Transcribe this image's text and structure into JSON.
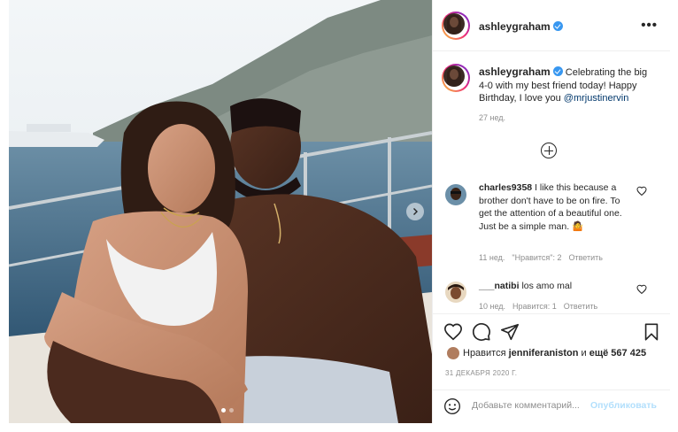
{
  "header": {
    "username": "ashleygraham",
    "more_icon": "more-horizontal-icon"
  },
  "caption": {
    "username": "ashleygraham",
    "text": "Celebrating the big 4-0 with my best friend today! Happy Birthday, I love you",
    "mention": "@mrjustinervin",
    "time": "27 нед."
  },
  "comments": [
    {
      "username": "charles9358",
      "text": "I like this because a brother don't have to be on fire. To get the attention of a beautiful one. Just be a simple man.",
      "emoji": "🤷",
      "time": "11 нед.",
      "likes": "\"Нравится\": 2",
      "reply": "Ответить"
    },
    {
      "username": "___natibi",
      "text": "los amo mal",
      "time": "10 нед.",
      "likes": "Нравится: 1",
      "reply": "Ответить"
    }
  ],
  "likes": {
    "prefix": "Нравится",
    "user": "jenniferaniston",
    "middle": "и",
    "others": "ещё 567 425"
  },
  "date": "31 ДЕКАБРЯ 2020 Г.",
  "add_comment": {
    "placeholder": "Добавьте комментарий...",
    "post_label": "Опубликовать"
  },
  "carousel": {
    "slide_count": 2,
    "active_index": 0
  },
  "colors": {
    "verified": "#3897f0",
    "link": "#00376b",
    "post_disabled": "#b2dffc"
  }
}
